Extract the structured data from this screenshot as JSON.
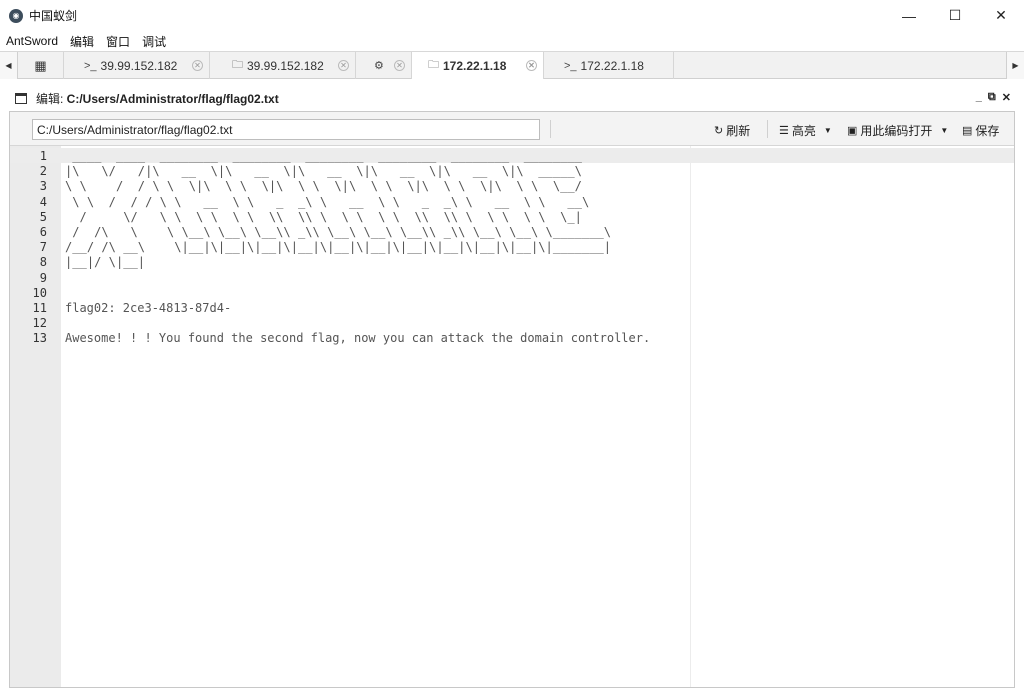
{
  "window": {
    "title": "中国蚁剑",
    "minimize": "—",
    "maximize": "☐",
    "close": "✕"
  },
  "menu": [
    "AntSword",
    "编辑",
    "窗口",
    "调试"
  ],
  "tabs": [
    {
      "icon": ">_",
      "label": "39.99.152.182",
      "active": false
    },
    {
      "icon": "folder",
      "label": "39.99.152.182",
      "active": false
    },
    {
      "icon": "gear",
      "label": "",
      "active": false
    },
    {
      "icon": "folder",
      "label": "172.22.1.18",
      "active": true
    },
    {
      "icon": ">_",
      "label": "172.22.1.18",
      "active": false
    }
  ],
  "panel": {
    "title_prefix": "编辑: ",
    "title_path": "C:/Users/Administrator/flag/flag02.txt"
  },
  "toolbar": {
    "path_value": "C:/Users/Administrator/flag/flag02.txt",
    "refresh_label": "刷新",
    "highlight_label": "高亮",
    "open_with_encoding_label": "用此编码打开",
    "save_label": "保存"
  },
  "editor": {
    "lines": [
      " ____  ____  ________  ________  ________  ________  ________  ________",
      "|\\   \\/   /|\\   __  \\|\\   __  \\|\\   __  \\|\\   __  \\|\\   __  \\|\\  _____\\",
      "\\ \\    /  / \\ \\  \\|\\  \\ \\  \\|\\  \\ \\  \\|\\  \\ \\  \\|\\  \\ \\  \\|\\  \\ \\  \\__/",
      " \\ \\  /  / / \\ \\   __  \\ \\   _  _\\ \\   __  \\ \\   _  _\\ \\   __  \\ \\   __\\",
      "  /     \\/   \\ \\  \\ \\  \\ \\  \\\\  \\\\ \\  \\ \\  \\ \\  \\\\  \\\\ \\  \\ \\  \\ \\  \\_|",
      " /  /\\   \\    \\ \\__\\ \\__\\ \\__\\\\ _\\\\ \\__\\ \\__\\ \\__\\\\ _\\\\ \\__\\ \\__\\ \\_______\\",
      "/__/ /\\ __\\    \\|__|\\|__|\\|__|\\|__|\\|__|\\|__|\\|__|\\|__|\\|__|\\|__|\\|_______|",
      "|__|/ \\|__|",
      "",
      "",
      "flag02: 2ce3-4813-87d4-",
      "",
      "Awesome! ! ! You found the second flag, now you can attack the domain controller."
    ]
  }
}
